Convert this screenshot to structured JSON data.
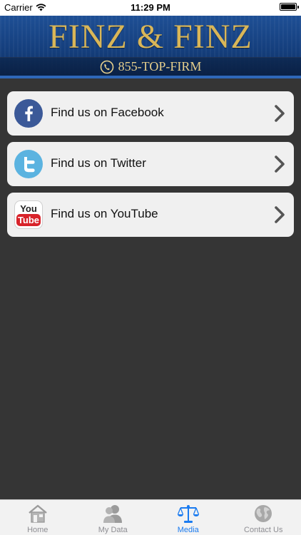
{
  "status_bar": {
    "carrier": "Carrier",
    "time": "11:29 PM"
  },
  "header": {
    "firm_name": "FINZ & FINZ",
    "phone": "855-TOP-FIRM"
  },
  "social_links": [
    {
      "label": "Find us on Facebook",
      "icon": "facebook-icon"
    },
    {
      "label": "Find us on Twitter",
      "icon": "twitter-icon"
    },
    {
      "label": "Find us on YouTube",
      "icon": "youtube-icon",
      "icon_text_top": "You",
      "icon_text_bottom": "Tube"
    }
  ],
  "tab_bar": {
    "active": "Media",
    "tabs": [
      {
        "label": "Home",
        "icon": "home-icon"
      },
      {
        "label": "My Data",
        "icon": "users-icon"
      },
      {
        "label": "Media",
        "icon": "scales-icon"
      },
      {
        "label": "Contact Us",
        "icon": "globe-icon"
      }
    ]
  },
  "colors": {
    "background": "#353535",
    "header_blue": "#1e4f95",
    "gold": "#d9b658",
    "card": "#f0f0f0",
    "active_tab": "#1a7bf0",
    "inactive_tab": "#8e8e93"
  }
}
